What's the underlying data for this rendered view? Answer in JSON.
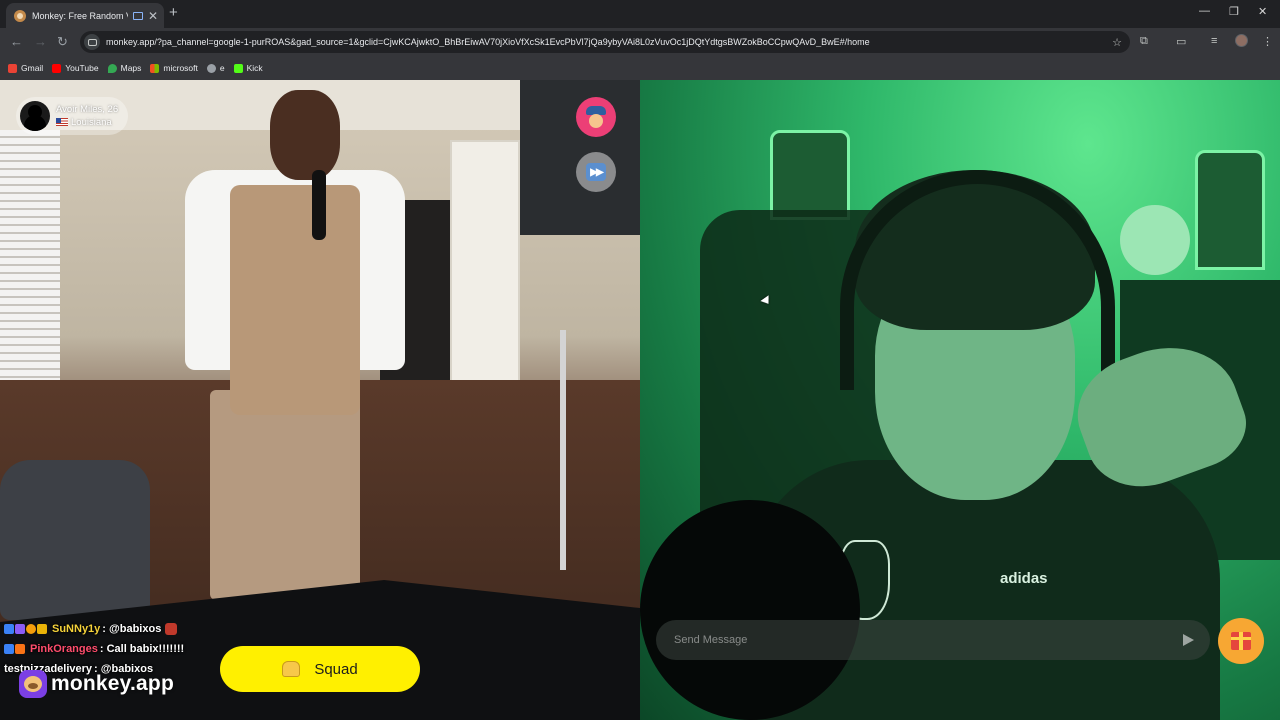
{
  "browser": {
    "tab_title": "Monkey: Free Random Vide",
    "tab_close": "✕",
    "new_tab": "+",
    "url": "monkey.app/?pa_channel=google-1-purROAS&gad_source=1&gclid=CjwKCAjwktO_BhBrEiwAV70jXioVfXcSk1EvcPbVl7jQa9ybyVAi8L0zVuvOc1jDQtYdtgsBWZokBoCCpwQAvD_BwE#/home",
    "bookmarks": [
      {
        "label": "Gmail",
        "color": "#ea4335"
      },
      {
        "label": "YouTube",
        "color": "#ff0000"
      },
      {
        "label": "Maps",
        "color": "#34a853"
      },
      {
        "label": "microsoft",
        "color": "#f25022"
      },
      {
        "label": "e",
        "color": "#9aa0a6"
      },
      {
        "label": "Kick",
        "color": "#53fc18"
      }
    ]
  },
  "partner": {
    "name_age": "Avoir Miles, 26",
    "location": "Louisiana"
  },
  "chat": [
    {
      "user": "SuNNy1y",
      "message": " : @babixos",
      "user_color": "#f5d23a",
      "badges": [
        "#3b82f6",
        "#8b5cf6",
        "#f59e0b",
        "#eab308"
      ],
      "emote": true
    },
    {
      "user": "PinkOranges",
      "message": " : Call babix!!!!!!!",
      "user_color": "#ff4d6d",
      "badges": [
        "#3b82f6",
        "#f97316"
      ],
      "emote": false
    },
    {
      "user": "testpizzadelivery",
      "message": " : @babixos",
      "user_color": "#ffffff",
      "badges": [],
      "emote": false
    }
  ],
  "brand": {
    "name": "monkey.app"
  },
  "squad": {
    "label": "Squad"
  },
  "message_input": {
    "placeholder": "Send Message"
  }
}
